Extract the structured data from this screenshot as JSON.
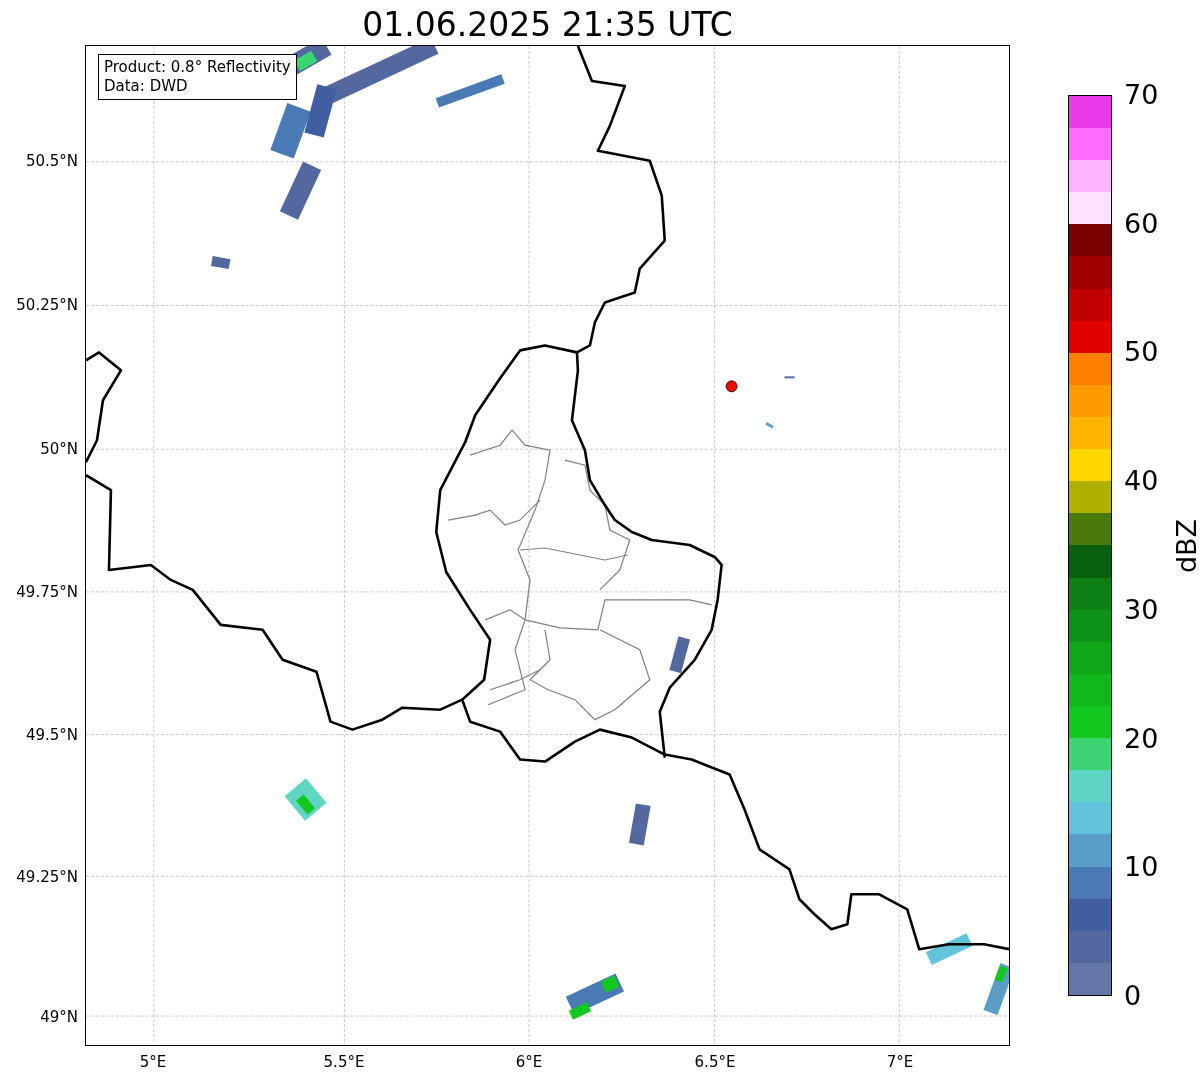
{
  "title": "01.06.2025 21:35 UTC",
  "map": {
    "legend": [
      "Product: 0.8° Reflectivity",
      "Data: DWD"
    ]
  },
  "x_ticks": [
    "5°E",
    "5.5°E",
    "6°E",
    "6.5°E",
    "7°E"
  ],
  "y_ticks": [
    "50.5°N",
    "50.25°N",
    "50°N",
    "49.75°N",
    "49.5°N",
    "49.25°N",
    "49°N"
  ],
  "colorbar": {
    "label": "dBZ",
    "ticks": [
      "70",
      "60",
      "50",
      "40",
      "30",
      "20",
      "10",
      "0"
    ],
    "bands": [
      {
        "color": "#6475a8"
      },
      {
        "color": "#5468a0"
      },
      {
        "color": "#415ea2"
      },
      {
        "color": "#4a7ab5"
      },
      {
        "color": "#5a9ec8"
      },
      {
        "color": "#64c3dc"
      },
      {
        "color": "#5fd6c4"
      },
      {
        "color": "#3cd472"
      },
      {
        "color": "#12c81e"
      },
      {
        "color": "#10b81c"
      },
      {
        "color": "#0fa619"
      },
      {
        "color": "#0e9217"
      },
      {
        "color": "#0c8014"
      },
      {
        "color": "#075f0f"
      },
      {
        "color": "#4a7a0a"
      },
      {
        "color": "#b0b000"
      },
      {
        "color": "#ffd700"
      },
      {
        "color": "#ffb400"
      },
      {
        "color": "#ff9a00"
      },
      {
        "color": "#ff7f00"
      },
      {
        "color": "#e00000"
      },
      {
        "color": "#c00000"
      },
      {
        "color": "#a00000"
      },
      {
        "color": "#7a0000"
      },
      {
        "color": "#ffe0ff"
      },
      {
        "color": "#ffb4ff"
      },
      {
        "color": "#ff6bff"
      },
      {
        "color": "#ea3aea"
      }
    ]
  }
}
